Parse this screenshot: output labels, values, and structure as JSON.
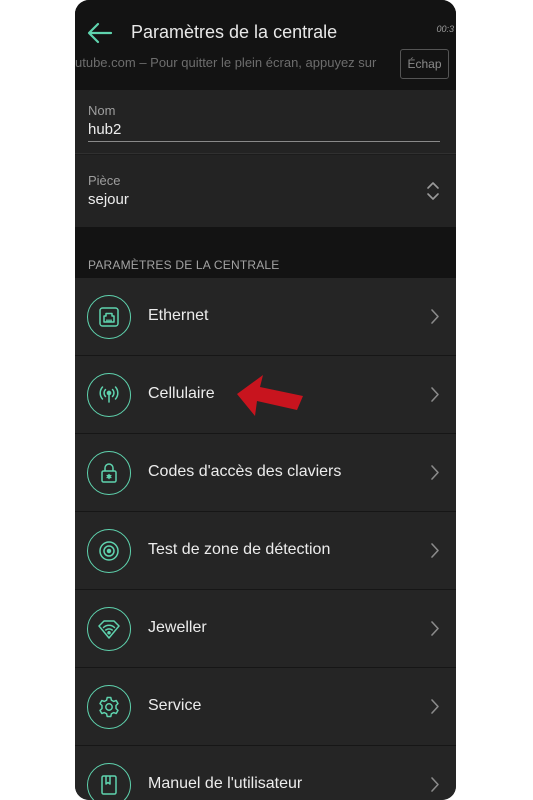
{
  "header": {
    "title": "Paramètres de la centrale",
    "timer": "00:3"
  },
  "fullscreen_overlay": {
    "text": "utube.com – Pour quitter le plein écran, appuyez sur",
    "key": "Échap"
  },
  "fields": {
    "name": {
      "label": "Nom",
      "value": "hub2"
    },
    "room": {
      "label": "Pièce",
      "value": "sejour"
    }
  },
  "section": {
    "title": "PARAMÈTRES DE LA CENTRALE"
  },
  "menu": [
    {
      "label": "Ethernet",
      "icon": "ethernet-icon"
    },
    {
      "label": "Cellulaire",
      "icon": "cellular-antenna-icon"
    },
    {
      "label": "Codes d'accès des claviers",
      "icon": "padlock-icon"
    },
    {
      "label": "Test de zone de détection",
      "icon": "detection-zone-icon"
    },
    {
      "label": "Jeweller",
      "icon": "jeweller-wifi-icon"
    },
    {
      "label": "Service",
      "icon": "gear-icon"
    },
    {
      "label": "Manuel de l'utilisateur",
      "icon": "manual-book-icon"
    }
  ],
  "colors": {
    "accent": "#5fd3ae",
    "annotation_arrow": "#c8141e",
    "background": "#1c1c1c"
  }
}
